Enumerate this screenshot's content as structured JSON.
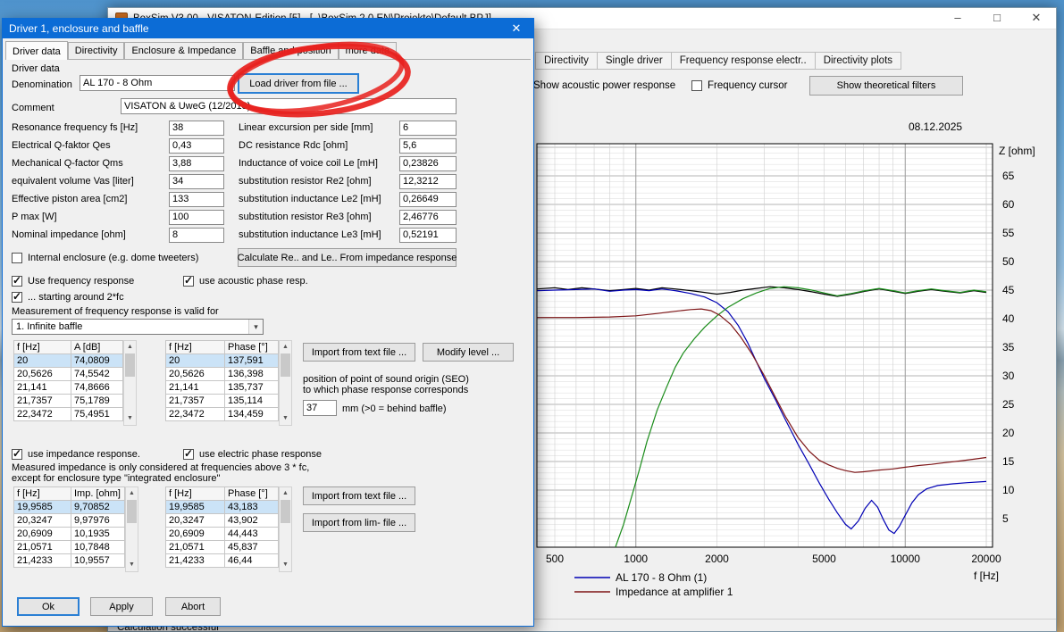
{
  "main_window": {
    "title": "BoxSim V3.00 - VISATON-Edition [5] - [..\\BoxSim 2.0 EN\\Projekte\\Default.BPJ]",
    "controls": {
      "minimize_glyph": "–",
      "maximize_glyph": "□",
      "close_glyph": "✕"
    },
    "tabs": [
      "Directivity",
      "Single driver",
      "Frequency response electr..",
      "Directivity plots"
    ],
    "toolbar": {
      "acoustic_power_label": "Show acoustic power response",
      "frequency_cursor_label": "Frequency cursor",
      "show_theoretical_filters": "Show theoretical filters"
    },
    "date": "08.12.2025",
    "status": "Calculation successful"
  },
  "chart_data": {
    "type": "line",
    "title": "",
    "xlabel": "f [Hz]",
    "ylabel": "Z [ohm]",
    "x_axis": {
      "scale": "log",
      "min": 430,
      "max": 21000,
      "ticks": [
        500,
        1000,
        2000,
        5000,
        10000,
        20000
      ]
    },
    "y_axis": {
      "min": 0,
      "max": 70,
      "tick_step": 5,
      "ticks": [
        5,
        10,
        15,
        20,
        25,
        30,
        35,
        40,
        45,
        50,
        55,
        60,
        65
      ]
    },
    "grid": "on",
    "legend_position": "bottom-left",
    "legend": [
      {
        "label": "AL 170 - 8 Ohm (1)",
        "color": "#0000b4"
      },
      {
        "label": "Impedance at amplifier 1",
        "color": "#7d1416"
      }
    ],
    "series": [
      {
        "name": "black-response",
        "color": "#000000",
        "points": [
          [
            430,
            45.2
          ],
          [
            500,
            45.4
          ],
          [
            560,
            45.1
          ],
          [
            630,
            45.4
          ],
          [
            700,
            45.2
          ],
          [
            800,
            44.9
          ],
          [
            900,
            45.1
          ],
          [
            1000,
            45.3
          ],
          [
            1120,
            45.0
          ],
          [
            1250,
            45.4
          ],
          [
            1400,
            45.2
          ],
          [
            1600,
            44.9
          ],
          [
            1800,
            44.6
          ],
          [
            2000,
            44.3
          ],
          [
            2240,
            44.6
          ],
          [
            2500,
            45.0
          ],
          [
            2800,
            45.3
          ],
          [
            3150,
            45.6
          ],
          [
            3550,
            45.4
          ],
          [
            4000,
            45.1
          ],
          [
            4500,
            44.7
          ],
          [
            5000,
            44.3
          ],
          [
            5600,
            43.9
          ],
          [
            6300,
            44.3
          ],
          [
            7100,
            44.8
          ],
          [
            8000,
            45.2
          ],
          [
            9000,
            44.8
          ],
          [
            10000,
            44.4
          ],
          [
            11200,
            44.8
          ],
          [
            12500,
            45.1
          ],
          [
            14000,
            44.8
          ],
          [
            16000,
            44.5
          ],
          [
            18000,
            44.9
          ],
          [
            20000,
            44.6
          ]
        ]
      },
      {
        "name": "blue-driver-response",
        "color": "#0000b4",
        "points": [
          [
            430,
            44.9
          ],
          [
            500,
            45.0
          ],
          [
            600,
            45.1
          ],
          [
            700,
            45.2
          ],
          [
            800,
            44.8
          ],
          [
            900,
            45.0
          ],
          [
            1000,
            45.1
          ],
          [
            1120,
            44.9
          ],
          [
            1250,
            45.2
          ],
          [
            1400,
            44.9
          ],
          [
            1600,
            44.4
          ],
          [
            1800,
            43.8
          ],
          [
            2000,
            42.8
          ],
          [
            2200,
            41.2
          ],
          [
            2400,
            38.8
          ],
          [
            2600,
            35.8
          ],
          [
            2800,
            32.5
          ],
          [
            3000,
            29.5
          ],
          [
            3300,
            25.8
          ],
          [
            3600,
            22.2
          ],
          [
            4000,
            18.0
          ],
          [
            4400,
            14.5
          ],
          [
            4800,
            11.2
          ],
          [
            5200,
            8.4
          ],
          [
            5600,
            6.0
          ],
          [
            6000,
            4.0
          ],
          [
            6300,
            3.2
          ],
          [
            6700,
            4.6
          ],
          [
            7100,
            6.8
          ],
          [
            7500,
            8.2
          ],
          [
            7900,
            7.0
          ],
          [
            8300,
            4.8
          ],
          [
            8700,
            3.0
          ],
          [
            9100,
            2.4
          ],
          [
            9500,
            3.6
          ],
          [
            10000,
            5.6
          ],
          [
            10600,
            7.8
          ],
          [
            11200,
            9.2
          ],
          [
            12000,
            10.2
          ],
          [
            13200,
            10.8
          ],
          [
            15000,
            11.1
          ],
          [
            17000,
            11.3
          ],
          [
            20000,
            11.5
          ]
        ]
      },
      {
        "name": "green-response",
        "color": "#1a8c1a",
        "points": [
          [
            840,
            0
          ],
          [
            900,
            4
          ],
          [
            960,
            8.5
          ],
          [
            1030,
            13.5
          ],
          [
            1100,
            18.5
          ],
          [
            1200,
            24
          ],
          [
            1300,
            28
          ],
          [
            1400,
            31.5
          ],
          [
            1500,
            34
          ],
          [
            1650,
            36.5
          ],
          [
            1800,
            38.5
          ],
          [
            2000,
            40.5
          ],
          [
            2200,
            42
          ],
          [
            2500,
            43.5
          ],
          [
            2800,
            44.5
          ],
          [
            3150,
            45.3
          ],
          [
            3550,
            45.6
          ],
          [
            4000,
            45.4
          ],
          [
            4500,
            45.0
          ],
          [
            5000,
            44.5
          ],
          [
            5600,
            44.0
          ],
          [
            6300,
            44.4
          ],
          [
            7100,
            44.9
          ],
          [
            8000,
            45.3
          ],
          [
            9000,
            44.9
          ],
          [
            10000,
            44.5
          ],
          [
            11200,
            44.9
          ],
          [
            12500,
            45.2
          ],
          [
            14000,
            44.9
          ],
          [
            16000,
            44.6
          ],
          [
            18000,
            45.0
          ],
          [
            20000,
            44.7
          ]
        ]
      },
      {
        "name": "darkred-impedance",
        "color": "#7d1416",
        "points": [
          [
            430,
            40.2
          ],
          [
            600,
            40.2
          ],
          [
            800,
            40.3
          ],
          [
            1000,
            40.5
          ],
          [
            1200,
            40.9
          ],
          [
            1400,
            41.3
          ],
          [
            1600,
            41.6
          ],
          [
            1750,
            41.7
          ],
          [
            1900,
            41.4
          ],
          [
            2050,
            40.6
          ],
          [
            2250,
            39.0
          ],
          [
            2450,
            36.8
          ],
          [
            2700,
            33.8
          ],
          [
            3000,
            30.0
          ],
          [
            3300,
            26.2
          ],
          [
            3600,
            22.8
          ],
          [
            4000,
            19.2
          ],
          [
            4400,
            16.8
          ],
          [
            4800,
            15.2
          ],
          [
            5200,
            14.4
          ],
          [
            5600,
            13.8
          ],
          [
            6000,
            13.4
          ],
          [
            6500,
            13.1
          ],
          [
            7000,
            13.2
          ],
          [
            8000,
            13.5
          ],
          [
            9000,
            13.7
          ],
          [
            10000,
            14.0
          ],
          [
            11200,
            14.3
          ],
          [
            12500,
            14.5
          ],
          [
            14000,
            14.8
          ],
          [
            16000,
            15.1
          ],
          [
            18000,
            15.4
          ],
          [
            20000,
            15.7
          ]
        ]
      }
    ]
  },
  "dialog": {
    "title": "Driver 1, enclosure and baffle",
    "close_glyph": "✕",
    "tabs": [
      "Driver data",
      "Directivity",
      "Enclosure & Impedance",
      "Baffle and position",
      "more data"
    ],
    "group_label": "Driver data",
    "denomination_label": "Denomination",
    "denomination_value": "AL 170 - 8 Ohm",
    "load_driver_button": "Load driver from file ...",
    "comment_label": "Comment",
    "comment_value": "VISATON & UweG (12/2018)",
    "params_left": [
      {
        "label": "Resonance frequency fs [Hz]",
        "value": "38"
      },
      {
        "label": "Electrical Q-faktor Qes",
        "value": "0,43"
      },
      {
        "label": "Mechanical Q-factor Qms",
        "value": "3,88"
      },
      {
        "label": "equivalent volume Vas [liter]",
        "value": "34"
      },
      {
        "label": "Effective piston area [cm2]",
        "value": "133"
      },
      {
        "label": "P max [W]",
        "value": "100"
      },
      {
        "label": "Nominal impedance [ohm]",
        "value": "8"
      }
    ],
    "params_right": [
      {
        "label": "Linear excursion per side [mm]",
        "value": "6"
      },
      {
        "label": "DC resistance Rdc [ohm]",
        "value": "5,6"
      },
      {
        "label": "Inductance of voice coil Le [mH]",
        "value": "0,23826"
      },
      {
        "label": "substitution resistor Re2 [ohm]",
        "value": "12,3212"
      },
      {
        "label": "substitution inductance Le2 [mH]",
        "value": "0,26649"
      },
      {
        "label": "substitution resistor Re3 [ohm]",
        "value": "2,46776"
      },
      {
        "label": "substitution inductance Le3 [mH]",
        "value": "0,52191"
      }
    ],
    "internal_enclosure_label": "Internal enclosure (e.g. dome tweeters)",
    "calc_re_le_button": "Calculate Re.. and Le.. From impedance response",
    "use_freq_label": "Use frequency response",
    "use_acoustic_phase_label": "use acoustic phase resp.",
    "starting_label": "... starting around 2*fc",
    "measurement_label": "Measurement of frequency response is valid for",
    "baffle_selected_option": "1. Infinite baffle",
    "freq_table": {
      "headers": [
        "f [Hz]",
        "A [dB]"
      ],
      "rows": [
        [
          "20",
          "74,0809"
        ],
        [
          "20,5626",
          "74,5542"
        ],
        [
          "21,141",
          "74,8666"
        ],
        [
          "21,7357",
          "75,1789"
        ],
        [
          "22,3472",
          "75,4951"
        ]
      ]
    },
    "phase_table": {
      "headers": [
        "f [Hz]",
        "Phase [°]"
      ],
      "rows": [
        [
          "20",
          "137,591"
        ],
        [
          "20,5626",
          "136,398"
        ],
        [
          "21,141",
          "135,737"
        ],
        [
          "21,7357",
          "135,114"
        ],
        [
          "22,3472",
          "134,459"
        ]
      ]
    },
    "import_text_button1": "Import from text file ...",
    "modify_level_button": "Modify level ...",
    "seo_text1": "position of point of sound origin (SEO)",
    "seo_text2": "to which phase response corresponds",
    "seo_value": "37",
    "seo_unit": "mm (>0 = behind baffle)",
    "use_impedance_label": "use impedance response.",
    "use_electric_phase_label": "use electric phase response",
    "impedance_note1": "Measured impedance is only considered at frequencies above 3 * fc,",
    "impedance_note2": "except for enclosure type \"integrated enclosure\"",
    "imp_table": {
      "headers": [
        "f [Hz]",
        "Imp. [ohm]"
      ],
      "rows": [
        [
          "19,9585",
          "9,70852"
        ],
        [
          "20,3247",
          "9,97976"
        ],
        [
          "20,6909",
          "10,1935"
        ],
        [
          "21,0571",
          "10,7848"
        ],
        [
          "21,4233",
          "10,9557"
        ]
      ]
    },
    "imp_phase_table": {
      "headers": [
        "f [Hz]",
        "Phase [°]"
      ],
      "rows": [
        [
          "19,9585",
          "43,183"
        ],
        [
          "20,3247",
          "43,902"
        ],
        [
          "20,6909",
          "44,443"
        ],
        [
          "21,0571",
          "45,837"
        ],
        [
          "21,4233",
          "46,44"
        ]
      ]
    },
    "import_text_button2": "Import from text file ...",
    "import_lim_button": "Import from lim- file ...",
    "ok_button": "Ok",
    "apply_button": "Apply",
    "abort_button": "Abort"
  }
}
